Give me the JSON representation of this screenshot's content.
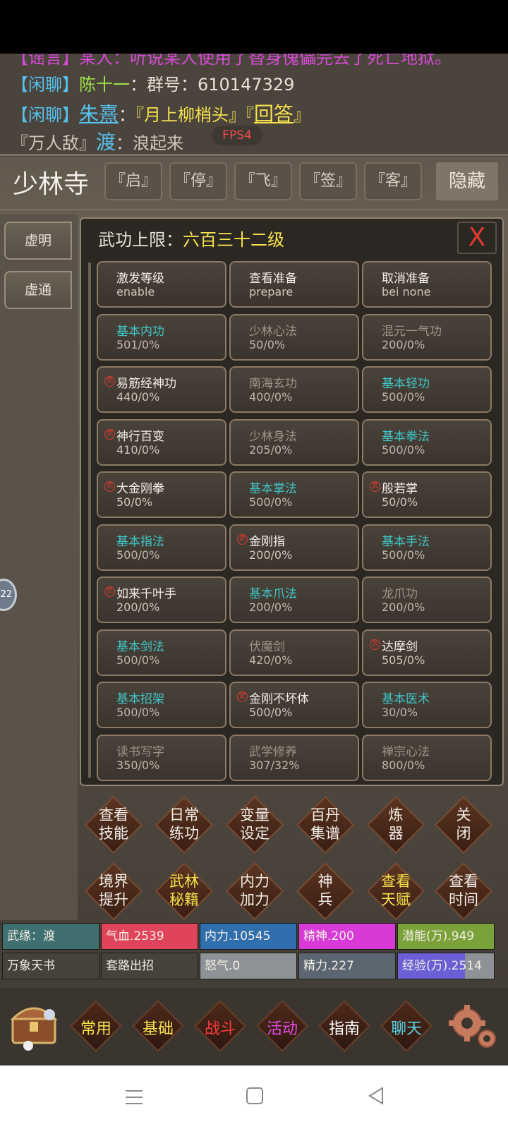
{
  "chat": {
    "cut_line": "【谣言】某人：听说某人使用了替身傀儡完去了死亡地狱。",
    "line1": {
      "channel": "【闲聊】",
      "name": "陈十一",
      "sep": "：",
      "text": "群号：610147329"
    },
    "line2": {
      "channel": "【闲聊】",
      "name": "朱熹",
      "sep": "：",
      "text": "『月上柳梢头』",
      "link_open": "『",
      "link": "回答",
      "link_close": "』"
    },
    "line3": {
      "title": "『万人敌』",
      "name": "渡",
      "sep": "：",
      "text": "浪起来"
    },
    "fps": "FPS4"
  },
  "header": {
    "place": "少林寺",
    "buttons": [
      "『启』",
      "『停』",
      "『飞』",
      "『签』",
      "『客』"
    ],
    "hide": "隐藏"
  },
  "sidebar": {
    "tabs": [
      "虚明",
      "虚通"
    ],
    "knob": "22"
  },
  "panel": {
    "title_prefix": "武功上限：",
    "title_level": "六百三十二级",
    "close": "X",
    "cells": [
      {
        "name": "激发等级",
        "value": "enable",
        "style": "white",
        "mark": false
      },
      {
        "name": "查看准备",
        "value": "prepare",
        "style": "white",
        "mark": false
      },
      {
        "name": "取消准备",
        "value": "bei none",
        "style": "white",
        "mark": false
      },
      {
        "name": "基本内功",
        "value": "501/0%",
        "style": "cyan",
        "mark": false
      },
      {
        "name": "少林心法",
        "value": "50/0%",
        "style": "gray",
        "mark": false
      },
      {
        "name": "混元一气功",
        "value": "200/0%",
        "style": "gray",
        "mark": false
      },
      {
        "name": "易筋经神功",
        "value": "440/0%",
        "style": "white",
        "mark": true
      },
      {
        "name": "南海玄功",
        "value": "400/0%",
        "style": "gray",
        "mark": false
      },
      {
        "name": "基本轻功",
        "value": "500/0%",
        "style": "cyan",
        "mark": false
      },
      {
        "name": "神行百变",
        "value": "410/0%",
        "style": "white",
        "mark": true
      },
      {
        "name": "少林身法",
        "value": "205/0%",
        "style": "gray",
        "mark": false
      },
      {
        "name": "基本拳法",
        "value": "500/0%",
        "style": "cyan",
        "mark": false
      },
      {
        "name": "大金刚拳",
        "value": "50/0%",
        "style": "white",
        "mark": true
      },
      {
        "name": "基本掌法",
        "value": "500/0%",
        "style": "cyan",
        "mark": false
      },
      {
        "name": "般若掌",
        "value": "50/0%",
        "style": "white",
        "mark": true
      },
      {
        "name": "基本指法",
        "value": "500/0%",
        "style": "cyan",
        "mark": false
      },
      {
        "name": "金刚指",
        "value": "200/0%",
        "style": "white",
        "mark": true
      },
      {
        "name": "基本手法",
        "value": "500/0%",
        "style": "cyan",
        "mark": false
      },
      {
        "name": "如来千叶手",
        "value": "200/0%",
        "style": "white",
        "mark": true
      },
      {
        "name": "基本爪法",
        "value": "200/0%",
        "style": "cyan",
        "mark": false
      },
      {
        "name": "龙爪功",
        "value": "200/0%",
        "style": "gray",
        "mark": false
      },
      {
        "name": "基本剑法",
        "value": "500/0%",
        "style": "cyan",
        "mark": false
      },
      {
        "name": "伏魔剑",
        "value": "420/0%",
        "style": "gray",
        "mark": false
      },
      {
        "name": "达摩剑",
        "value": "505/0%",
        "style": "white",
        "mark": true
      },
      {
        "name": "基本招架",
        "value": "500/0%",
        "style": "cyan",
        "mark": false
      },
      {
        "name": "金刚不坏体",
        "value": "500/0%",
        "style": "white",
        "mark": true
      },
      {
        "name": "基本医术",
        "value": "30/0%",
        "style": "cyan",
        "mark": false
      },
      {
        "name": "读书写字",
        "value": "350/0%",
        "style": "gray",
        "mark": false
      },
      {
        "name": "武学修养",
        "value": "307/32%",
        "style": "gray",
        "mark": false
      },
      {
        "name": "禅宗心法",
        "value": "800/0%",
        "style": "gray",
        "mark": false
      }
    ],
    "mark_glyph": "武"
  },
  "actions": [
    {
      "l1": "查看",
      "l2": "技能",
      "yellow": false
    },
    {
      "l1": "日常",
      "l2": "练功",
      "yellow": false
    },
    {
      "l1": "变量",
      "l2": "设定",
      "yellow": false
    },
    {
      "l1": "百丹",
      "l2": "集谱",
      "yellow": false
    },
    {
      "l1": "炼",
      "l2": "器",
      "yellow": false
    },
    {
      "l1": "关",
      "l2": "闭",
      "yellow": false
    },
    {
      "l1": "境界",
      "l2": "提升",
      "yellow": false
    },
    {
      "l1": "武林",
      "l2": "秘籍",
      "yellow": true
    },
    {
      "l1": "内力",
      "l2": "加力",
      "yellow": false
    },
    {
      "l1": "神",
      "l2": "兵",
      "yellow": false
    },
    {
      "l1": "查看",
      "l2": "天赋",
      "yellow": true
    },
    {
      "l1": "查看",
      "l2": "时间",
      "yellow": false
    }
  ],
  "stats": [
    {
      "label": "武缘：渡",
      "color": "#3f6f6e",
      "fill": 1
    },
    {
      "label": "气血.2539",
      "color": "#e0445a",
      "fill": 1
    },
    {
      "label": "内力.10545",
      "color": "#2f6fae",
      "fill": 1
    },
    {
      "label": "精神.200",
      "color": "#d83ad8",
      "fill": 1
    },
    {
      "label": "潜能(万).949",
      "color": "#7aa13a",
      "fill": 1
    },
    {
      "label": "万象天书",
      "color": "#46413b",
      "fill": 1
    },
    {
      "label": "套路出招",
      "color": "#46413b",
      "fill": 1
    },
    {
      "label": "怒气.0",
      "color": "#8e9296",
      "fill": 1
    },
    {
      "label": "精力.227",
      "color": "#5c6670",
      "fill": 1
    },
    {
      "label": "经验(万).2514",
      "color": "#6b5fd6",
      "fill": 0.7
    }
  ],
  "bottomnav": [
    {
      "label": "常用",
      "color": "#f5e14c"
    },
    {
      "label": "基础",
      "color": "#f5e14c"
    },
    {
      "label": "战斗",
      "color": "#ff3a3a"
    },
    {
      "label": "活动",
      "color": "#e84ae8"
    },
    {
      "label": "指南",
      "color": "#ffffff"
    },
    {
      "label": "聊天",
      "color": "#56d6e6"
    }
  ],
  "icons": {
    "chest": "treasure-chest-icon",
    "gear": "gear-icon",
    "sys_menu": "menu-icon",
    "sys_home": "home-icon",
    "sys_back": "back-icon"
  }
}
